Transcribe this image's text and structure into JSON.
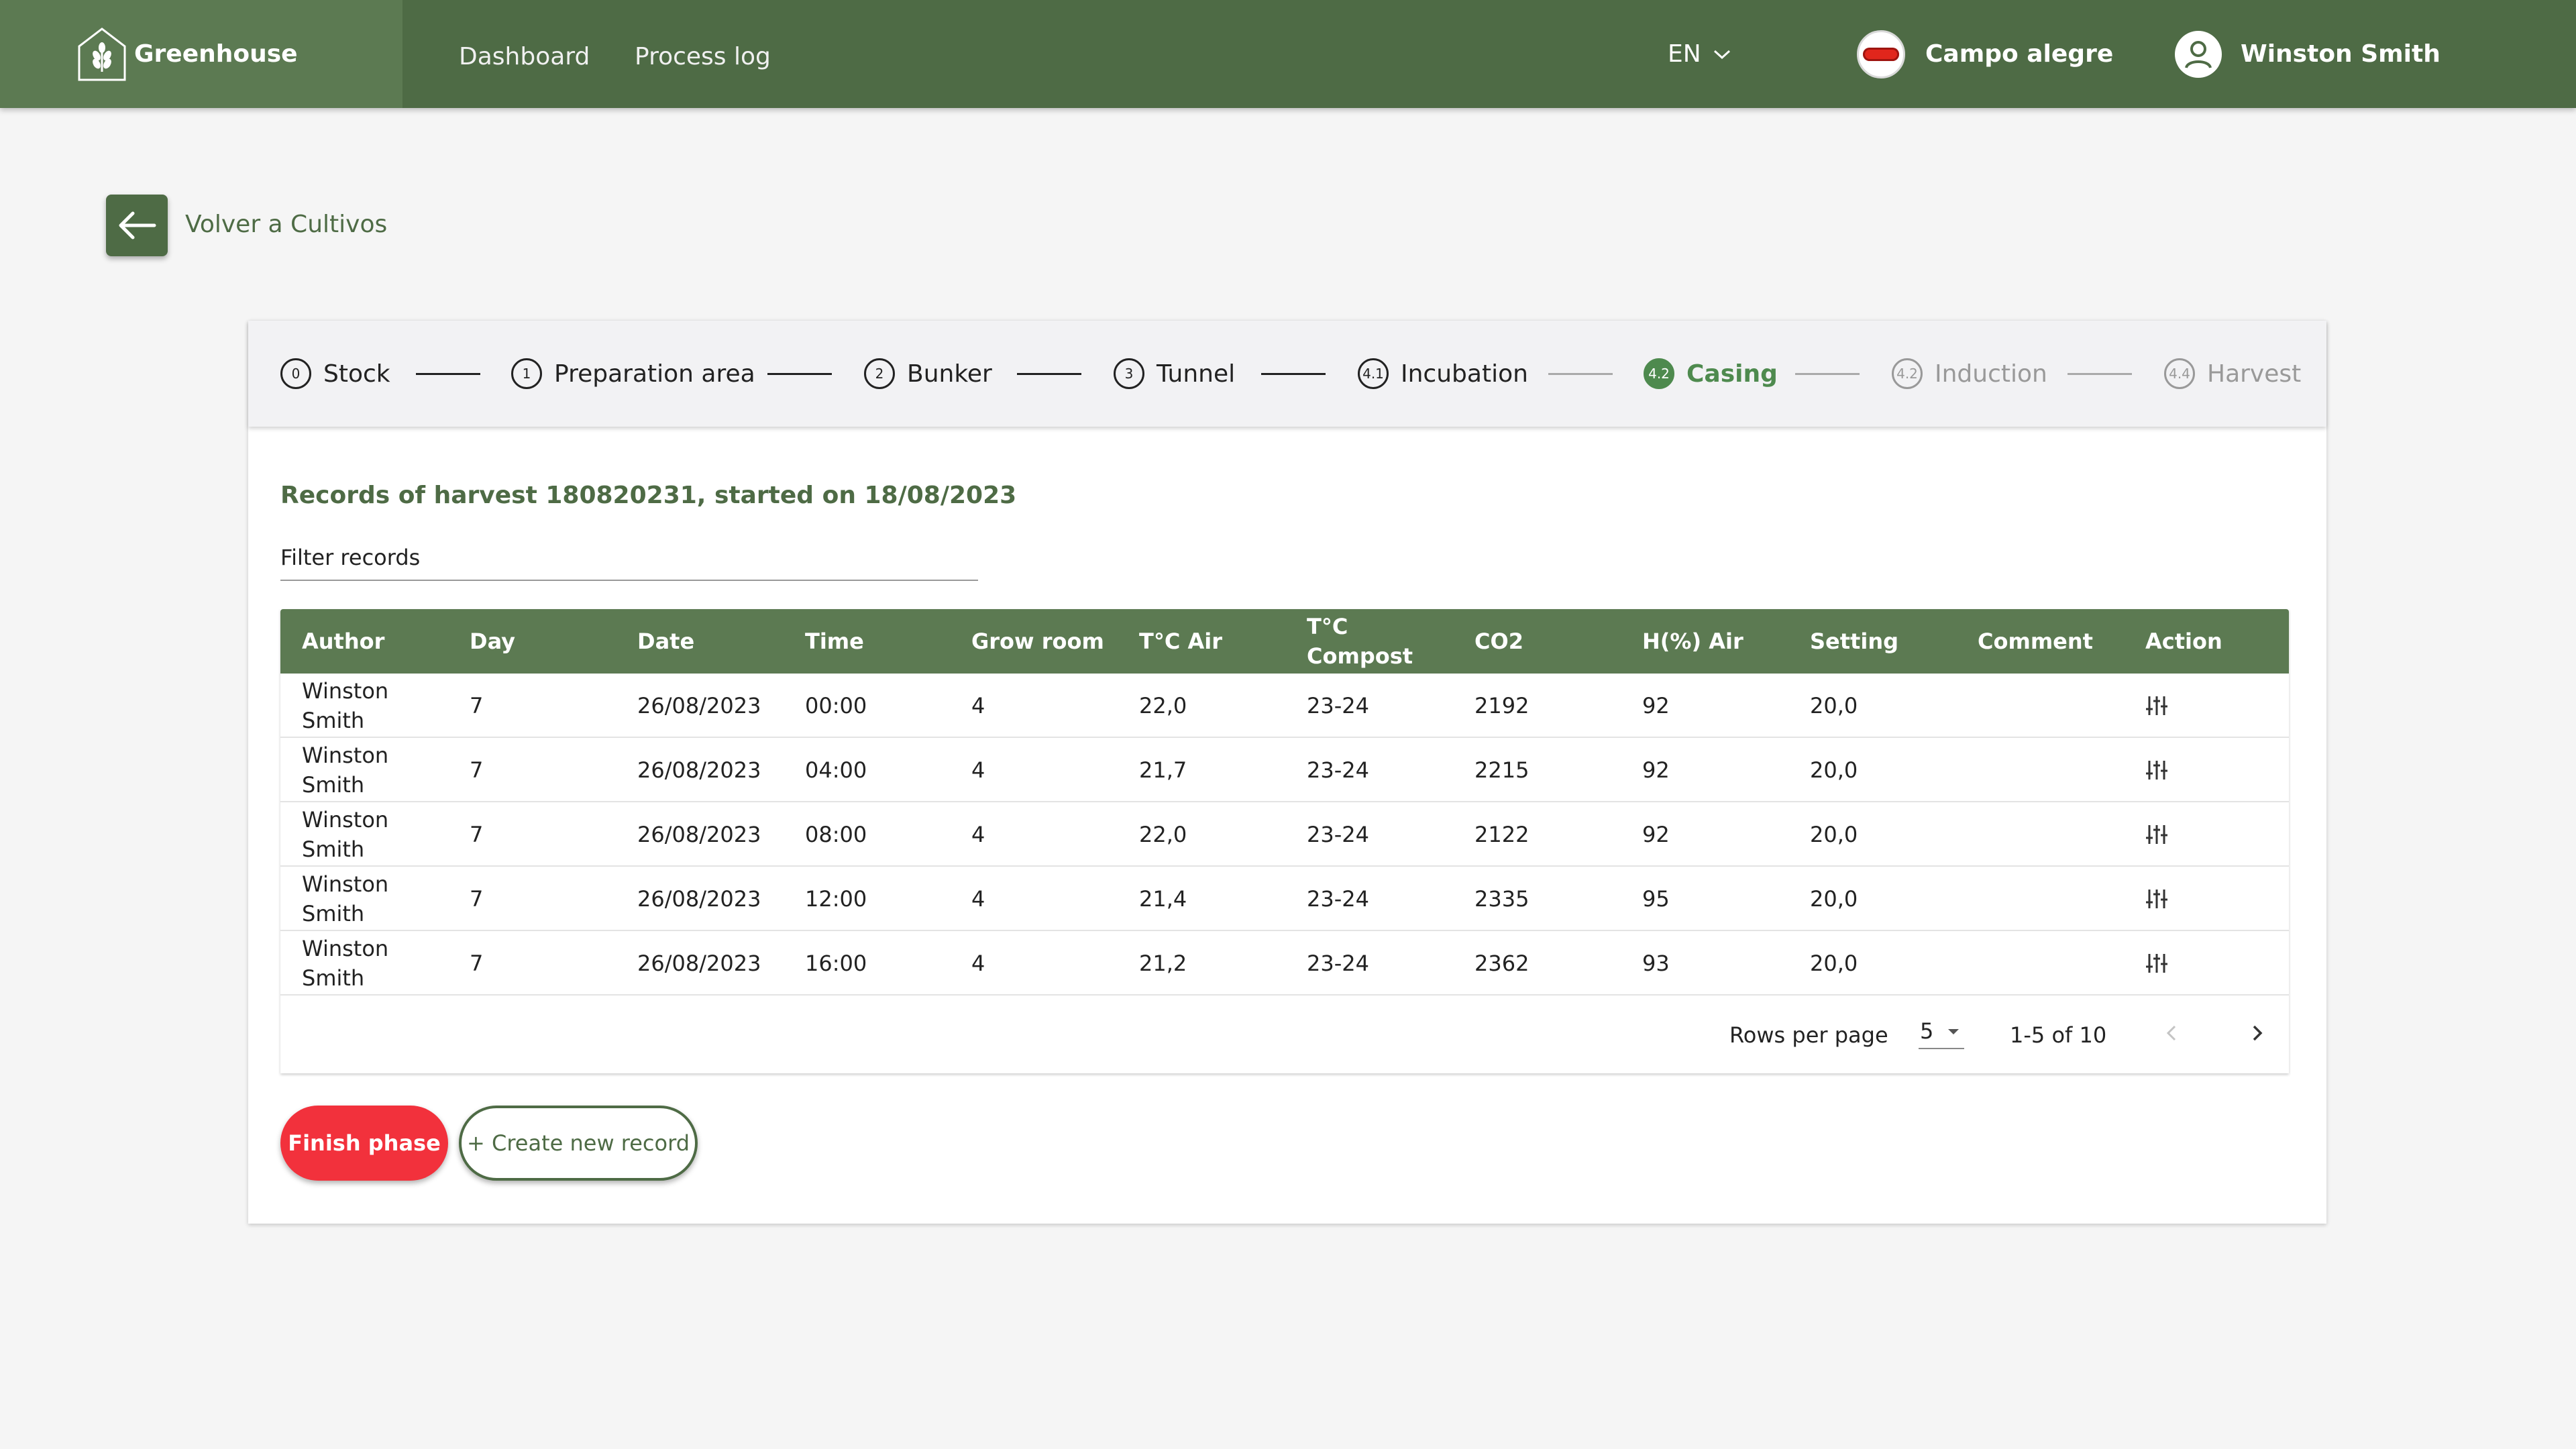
{
  "header": {
    "brand": "Greenhouse",
    "nav": [
      "Dashboard",
      "Process log"
    ],
    "language": "EN",
    "farm": "Campo alegre",
    "user": "Winston Smith"
  },
  "back": {
    "label": "Volver a Cultivos"
  },
  "stepper": [
    {
      "num": "0",
      "label": "Stock",
      "state": "done"
    },
    {
      "num": "1",
      "label": "Preparation area",
      "state": "done"
    },
    {
      "num": "2",
      "label": "Bunker",
      "state": "done"
    },
    {
      "num": "3",
      "label": "Tunnel",
      "state": "done"
    },
    {
      "num": "4.1",
      "label": "Incubation",
      "state": "done"
    },
    {
      "num": "4.2",
      "label": "Casing",
      "state": "active"
    },
    {
      "num": "4.2",
      "label": "Induction",
      "state": "disabled"
    },
    {
      "num": "4.4",
      "label": "Harvest",
      "state": "disabled"
    }
  ],
  "records": {
    "title": "Records of harvest 180820231, started on 18/08/2023",
    "filter_placeholder": "Filter records"
  },
  "table": {
    "columns": [
      "Author",
      "Day",
      "Date",
      "Time",
      "Grow room",
      "T°C Air",
      "T°C Compost",
      "CO2",
      "H(%) Air",
      "Setting",
      "Comment",
      "Action"
    ],
    "rows": [
      {
        "author": "Winston Smith",
        "day": "7",
        "date": "26/08/2023",
        "time": "00:00",
        "room": "4",
        "air": "22,0",
        "compost": "23-24",
        "co2": "2192",
        "hum": "92",
        "setting": "20,0",
        "comment": ""
      },
      {
        "author": "Winston Smith",
        "day": "7",
        "date": "26/08/2023",
        "time": "04:00",
        "room": "4",
        "air": "21,7",
        "compost": "23-24",
        "co2": "2215",
        "hum": "92",
        "setting": "20,0",
        "comment": ""
      },
      {
        "author": "Winston Smith",
        "day": "7",
        "date": "26/08/2023",
        "time": "08:00",
        "room": "4",
        "air": "22,0",
        "compost": "23-24",
        "co2": "2122",
        "hum": "92",
        "setting": "20,0",
        "comment": ""
      },
      {
        "author": "Winston Smith",
        "day": "7",
        "date": "26/08/2023",
        "time": "12:00",
        "room": "4",
        "air": "21,4",
        "compost": "23-24",
        "co2": "2335",
        "hum": "95",
        "setting": "20,0",
        "comment": ""
      },
      {
        "author": "Winston Smith",
        "day": "7",
        "date": "26/08/2023",
        "time": "16:00",
        "room": "4",
        "air": "21,2",
        "compost": "23-24",
        "co2": "2362",
        "hum": "93",
        "setting": "20,0",
        "comment": ""
      }
    ]
  },
  "pagination": {
    "rows_per_page_label": "Rows per page",
    "rows_per_page": "5",
    "range": "1-5 of 10"
  },
  "actions": {
    "finish": "Finish phase",
    "create": "+ Create new record"
  },
  "colors": {
    "primary": "#4e6b45",
    "active_step": "#4e8a4e",
    "danger": "#f2313c"
  }
}
